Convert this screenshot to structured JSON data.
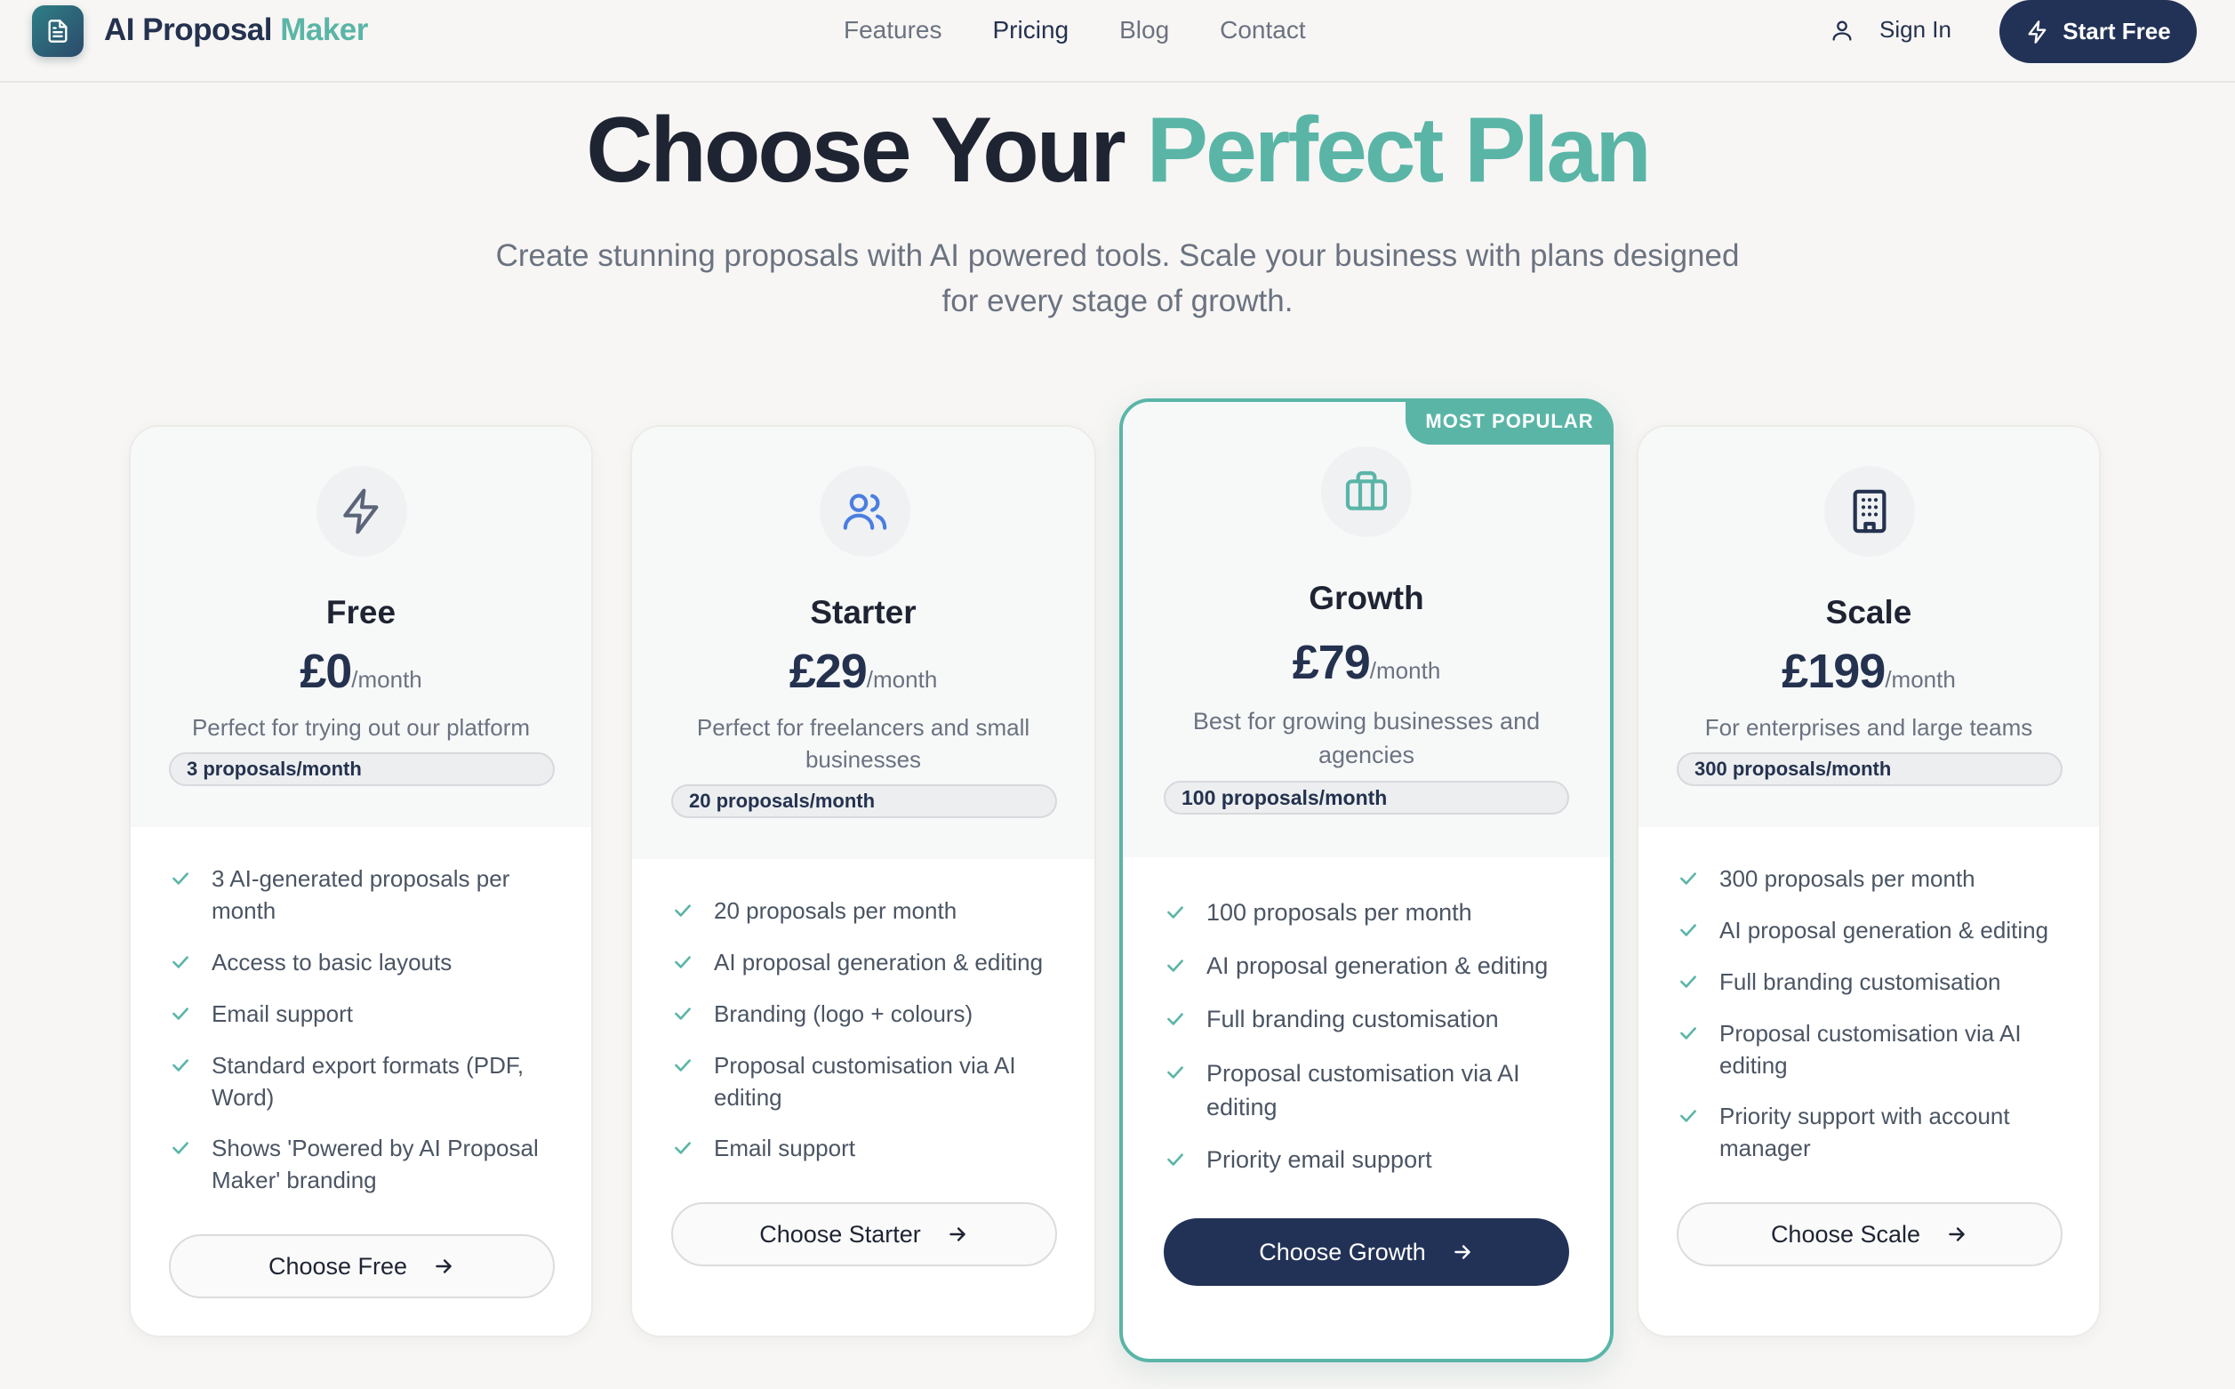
{
  "nav": {
    "brand_a": "AI Proposal",
    "brand_b": "Maker",
    "links": [
      "Features",
      "Pricing",
      "Blog",
      "Contact"
    ],
    "active_link": "Pricing",
    "sign_in": "Sign In",
    "start_free": "Start Free"
  },
  "hero": {
    "title_a": "Choose Your",
    "title_b": "Perfect Plan",
    "subtitle": "Create stunning proposals with AI powered tools. Scale your business with plans designed for every stage of growth."
  },
  "colors": {
    "accent": "#5ab5a7",
    "primary": "#223257",
    "text": "#1f2433",
    "muted": "#6b7280"
  },
  "plans": [
    {
      "name": "Free",
      "price": "£0",
      "per": "/month",
      "desc": "Perfect for trying out our platform",
      "quota": "3 proposals/month",
      "icon": "lightning-icon",
      "features": [
        "3 AI-generated proposals per month",
        "Access to basic layouts",
        "Email support",
        "Standard export formats (PDF, Word)",
        "Shows 'Powered by AI Proposal Maker' branding"
      ],
      "cta": "Choose Free"
    },
    {
      "name": "Starter",
      "price": "£29",
      "per": "/month",
      "desc": "Perfect for freelancers and small businesses",
      "quota": "20 proposals/month",
      "icon": "users-icon",
      "features": [
        "20 proposals per month",
        "AI proposal generation & editing",
        "Branding (logo + colours)",
        "Proposal customisation via AI editing",
        "Email support"
      ],
      "cta": "Choose Starter"
    },
    {
      "name": "Growth",
      "price": "£79",
      "per": "/month",
      "desc": "Best for growing businesses and agencies",
      "quota": "100 proposals/month",
      "icon": "briefcase-icon",
      "badge": "MOST POPULAR",
      "features": [
        "100 proposals per month",
        "AI proposal generation & editing",
        "Full branding customisation",
        "Proposal customisation via AI editing",
        "Priority email support"
      ],
      "cta": "Choose Growth"
    },
    {
      "name": "Scale",
      "price": "£199",
      "per": "/month",
      "desc": "For enterprises and large teams",
      "quota": "300 proposals/month",
      "icon": "building-icon",
      "features": [
        "300 proposals per month",
        "AI proposal generation & editing",
        "Full branding customisation",
        "Proposal customisation via AI editing",
        "Priority support with account manager"
      ],
      "cta": "Choose Scale"
    }
  ]
}
